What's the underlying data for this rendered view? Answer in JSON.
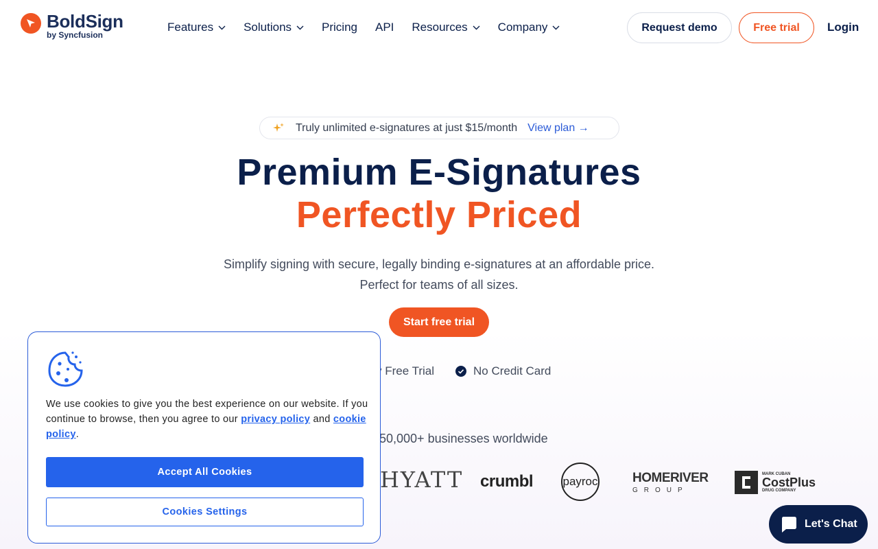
{
  "header": {
    "logo_name": "BoldSign",
    "logo_sub": "by Syncfusion",
    "nav": [
      {
        "label": "Features"
      },
      {
        "label": "Solutions"
      },
      {
        "label": "Pricing"
      },
      {
        "label": "API"
      },
      {
        "label": "Resources"
      },
      {
        "label": "Company"
      }
    ],
    "request_demo": "Request demo",
    "free_trial": "Free trial",
    "login": "Login"
  },
  "hero": {
    "promo_text": "Truly unlimited e-signatures at just $15/month",
    "promo_link": "View plan →",
    "title_line1": "Premium E-Signatures",
    "title_line2": "Perfectly Priced",
    "lead_line1": "Simplify signing with secure, legally binding e-signatures at an affordable price.",
    "lead_line2": "Perfect for teams of all sizes.",
    "cta": "Start free trial",
    "feature_partial": "y Free Trial",
    "feature_2": "No Credit Card",
    "trusted_partial": "50,000+ businesses worldwide",
    "logos": {
      "hyatt": "HYATT",
      "crumbl": "crumbl",
      "payroc": "payroc",
      "homeriver_1": "HOMERIVER",
      "homeriver_2": "GROUP",
      "costplus_small": "MARK CUBAN",
      "costplus_big": "CostPlus",
      "costplus_sub": "DRUG COMPANY"
    }
  },
  "cookie": {
    "text_before": "We use cookies to give you the best experience on our website. If you continue to browse, then you agree to our ",
    "privacy_link": "privacy policy",
    "text_middle": " and ",
    "cookie_link": "cookie policy",
    "text_after": ".",
    "accept": "Accept All Cookies",
    "settings": "Cookies Settings"
  },
  "chat": {
    "label": "Let's Chat"
  },
  "colors": {
    "brand_orange": "#f05523",
    "navy": "#0b1f4a",
    "link_blue": "#2563eb"
  }
}
